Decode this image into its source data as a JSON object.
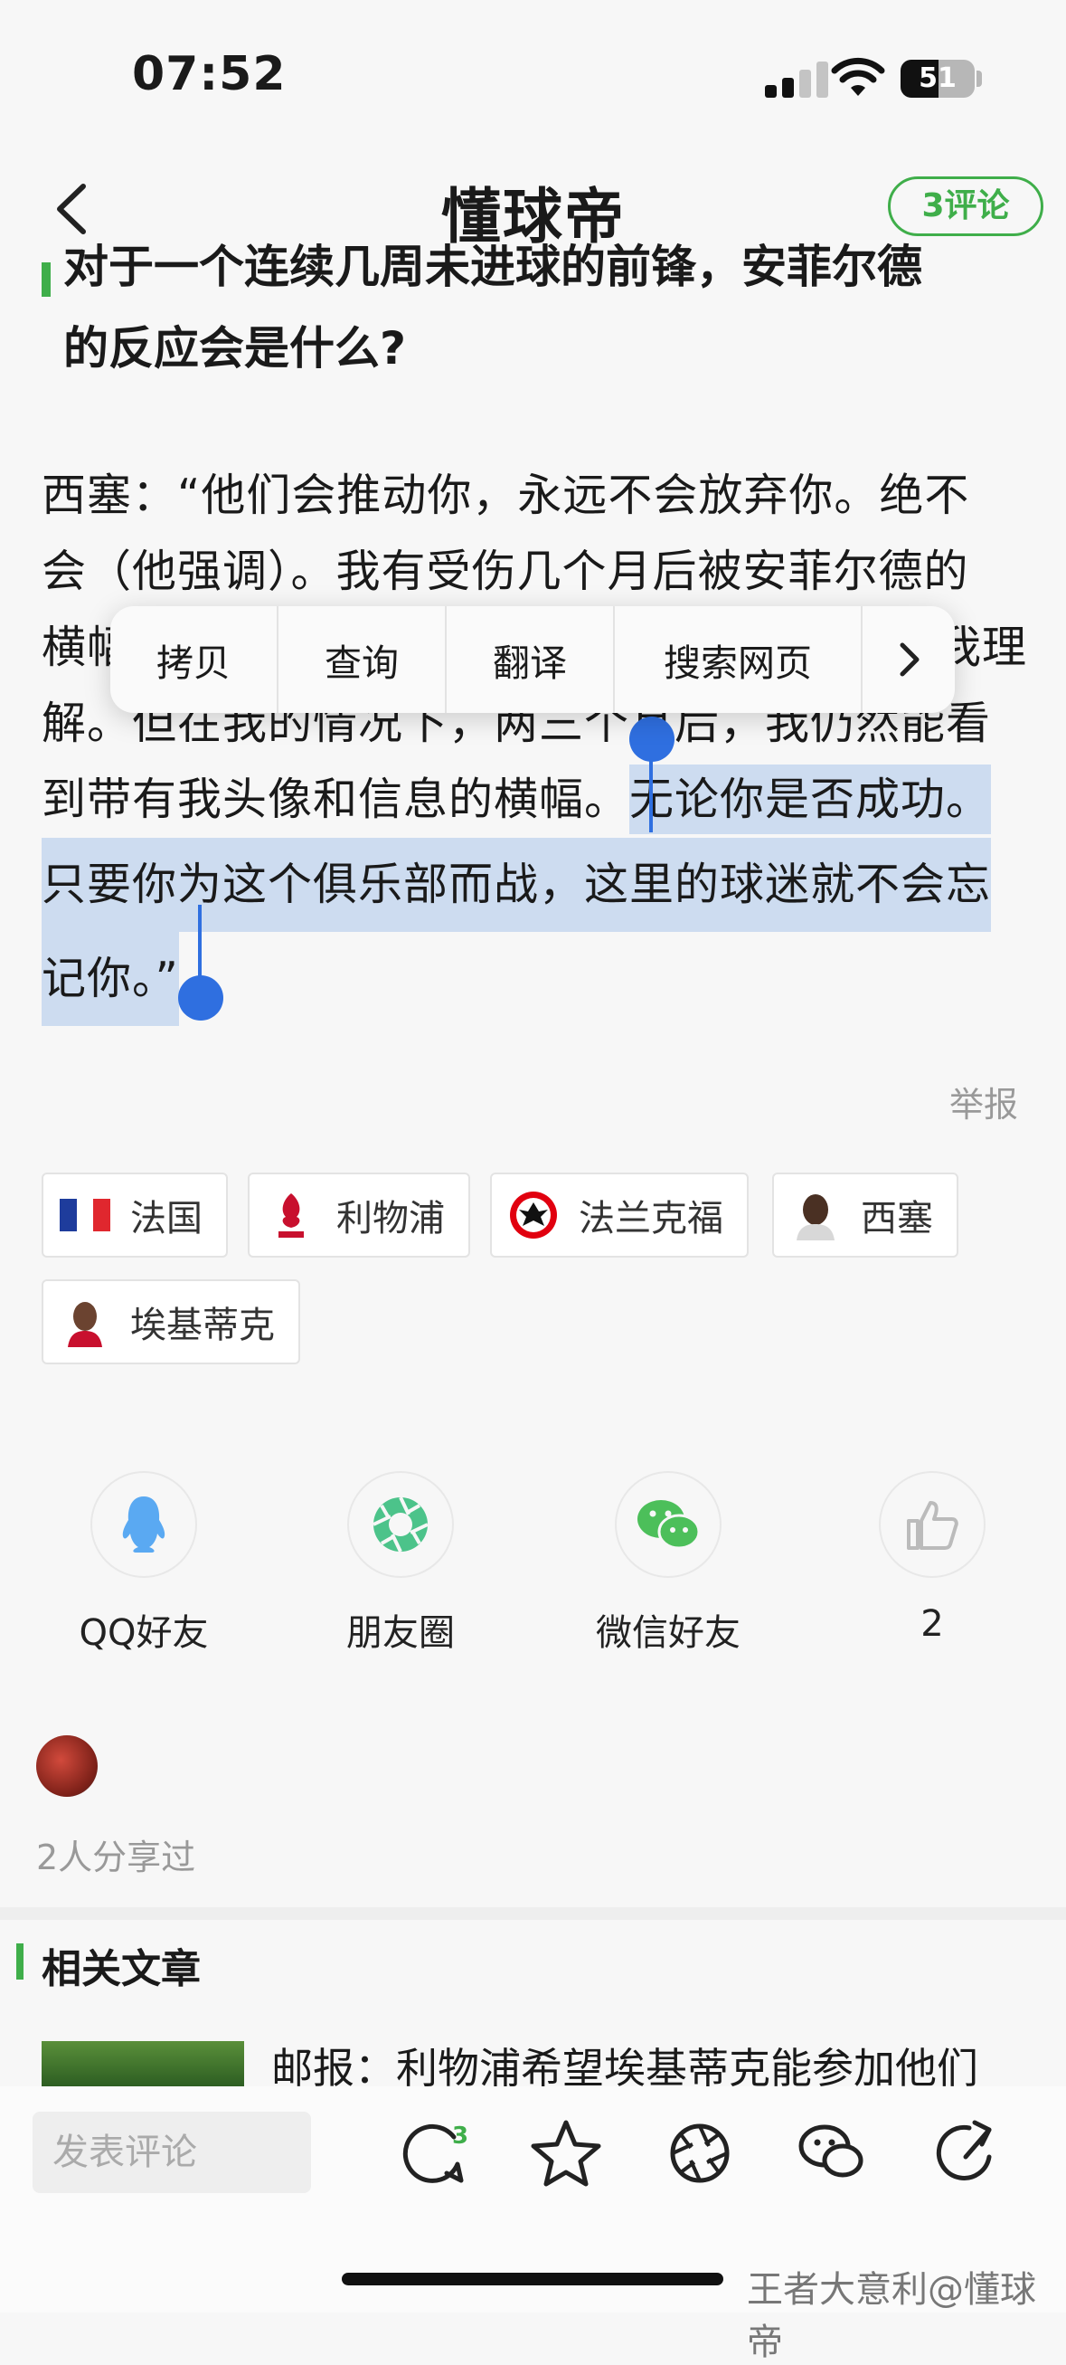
{
  "status_bar": {
    "time": "07:52",
    "battery": "51",
    "battery_level": 0.51,
    "icons": [
      "signal-icon",
      "wifi-icon",
      "battery-icon"
    ]
  },
  "nav": {
    "back_icon": "chevron-left-icon",
    "title": "懂球帝",
    "comments_button": "3评论"
  },
  "article": {
    "heading_line1": "对于一个连续几周未进球的前锋，安菲尔德",
    "heading_line2": "的反应会是什么?",
    "paragraph_lines": [
      "西塞：“他们会推动你，永远不会放弃你。绝不",
      "会（他强调）。我有受伤几个月后被安菲尔德的",
      "横幅",
      "我理",
      "解。但在我的情况下，两三个月后，我仍然能看",
      "到带有我头像和信息的横幅。"
    ],
    "selected_1": "无论你是否成功。",
    "selected_2": "只要你为这个俱乐部而战，这里的球迷就不会忘",
    "selected_3": "记你。”",
    "report": "举报"
  },
  "context_menu": {
    "items": [
      "拷贝",
      "查询",
      "翻译",
      "搜索网页"
    ],
    "more_icon": "chevron-right-icon"
  },
  "tags": [
    {
      "label": "法国",
      "icon": "france-flag-icon"
    },
    {
      "label": "利物浦",
      "icon": "liverpool-crest-icon"
    },
    {
      "label": "法兰克福",
      "icon": "frankfurt-crest-icon"
    },
    {
      "label": "西塞",
      "icon": "player-avatar-icon"
    },
    {
      "label": "埃基蒂克",
      "icon": "player-avatar-icon"
    }
  ],
  "share": {
    "qq": "QQ好友",
    "moments": "朋友圈",
    "wechat": "微信好友",
    "likes": "2"
  },
  "sharers": {
    "text": "2人分享过"
  },
  "related": {
    "title": "相关文章",
    "first_article": "邮报：利物浦希望埃基蒂克能参加他们"
  },
  "bottom_bar": {
    "comment_placeholder": "发表评论",
    "comment_count_badge": "3",
    "icons": [
      "comment-icon",
      "star-icon",
      "aperture-icon",
      "wechat-icon",
      "share-icon"
    ]
  },
  "watermark": "王者大意利@懂球帝",
  "colors": {
    "accent_green": "#3fae4a",
    "selection": "#cddcf0",
    "handle_blue": "#2f6fe0"
  }
}
